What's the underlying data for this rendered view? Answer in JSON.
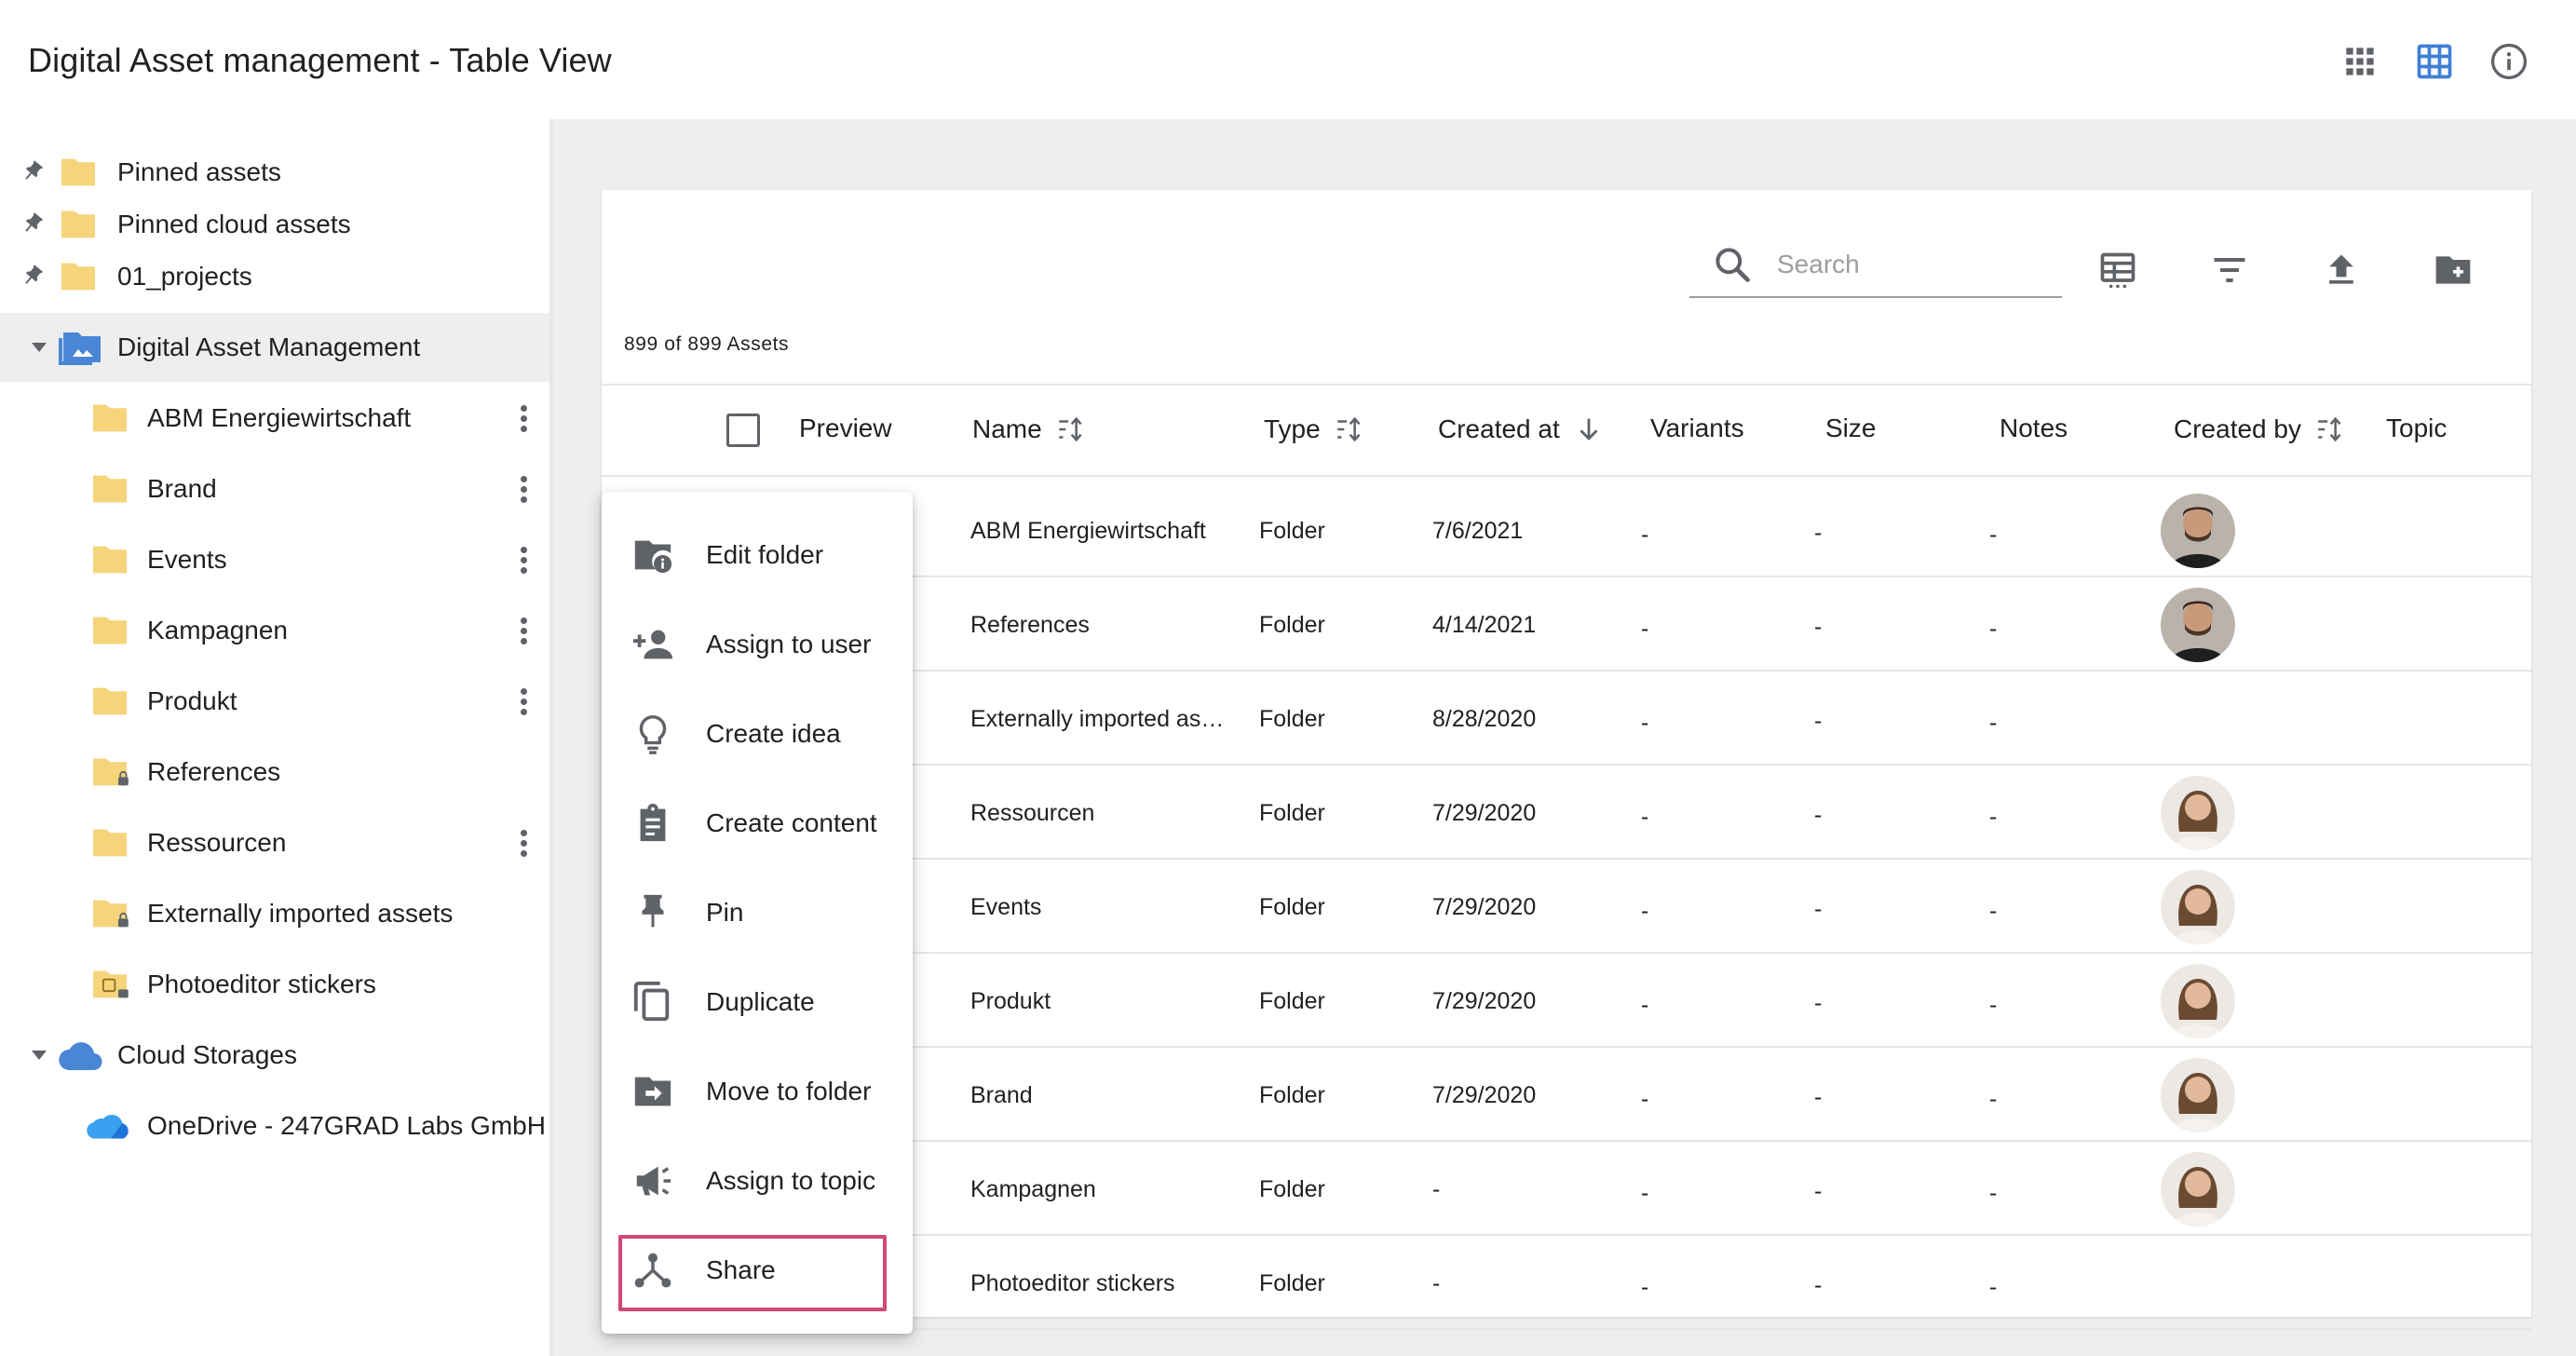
{
  "header": {
    "title": "Digital Asset management - Table View",
    "icons": [
      "grid-view-icon",
      "table-view-icon",
      "info-icon"
    ],
    "active_view_color": "#3f7fd6"
  },
  "sidebar": {
    "pinned": [
      {
        "label": "Pinned assets"
      },
      {
        "label": "Pinned cloud assets"
      },
      {
        "label": "01_projects"
      }
    ],
    "root": {
      "label": "Digital Asset Management"
    },
    "folders": [
      {
        "label": "ABM Energiewirtschaft",
        "menu": true,
        "locked": false
      },
      {
        "label": "Brand",
        "menu": true,
        "locked": false
      },
      {
        "label": "Events",
        "menu": true,
        "locked": false
      },
      {
        "label": "Kampagnen",
        "menu": true,
        "locked": false
      },
      {
        "label": "Produkt",
        "menu": true,
        "locked": false
      },
      {
        "label": "References",
        "menu": false,
        "locked": true
      },
      {
        "label": "Ressourcen",
        "menu": true,
        "locked": false
      },
      {
        "label": "Externally imported assets",
        "menu": false,
        "locked": true
      },
      {
        "label": "Photoeditor stickers",
        "menu": false,
        "locked": true
      }
    ],
    "cloud": {
      "label": "Cloud Storages"
    },
    "cloud_items": [
      {
        "label": "OneDrive - 247GRAD Labs GmbH"
      }
    ],
    "folder_color": "#f5d47a"
  },
  "toolbar": {
    "search_placeholder": "Search",
    "icons": [
      "column-settings-icon",
      "filter-icon",
      "upload-icon",
      "add-folder-icon"
    ]
  },
  "asset_count": "899 of 899 Assets",
  "table": {
    "columns": {
      "preview": "Preview",
      "name": "Name",
      "type": "Type",
      "created_at": "Created at",
      "variants": "Variants",
      "size": "Size",
      "notes": "Notes",
      "created_by": "Created by",
      "topic": "Topic"
    },
    "rows": [
      {
        "name": "ABM Energiewirtschaft",
        "type": "Folder",
        "created": "7/6/2021",
        "variants": "-",
        "size": "-",
        "notes": "-",
        "avatar": "male"
      },
      {
        "name": "References",
        "type": "Folder",
        "created": "4/14/2021",
        "variants": "-",
        "size": "-",
        "notes": "-",
        "avatar": "male"
      },
      {
        "name": "Externally imported ass...",
        "type": "Folder",
        "created": "8/28/2020",
        "variants": "-",
        "size": "-",
        "notes": "-",
        "avatar": "none"
      },
      {
        "name": "Ressourcen",
        "type": "Folder",
        "created": "7/29/2020",
        "variants": "-",
        "size": "-",
        "notes": "-",
        "avatar": "female"
      },
      {
        "name": "Events",
        "type": "Folder",
        "created": "7/29/2020",
        "variants": "-",
        "size": "-",
        "notes": "-",
        "avatar": "female"
      },
      {
        "name": "Produkt",
        "type": "Folder",
        "created": "7/29/2020",
        "variants": "-",
        "size": "-",
        "notes": "-",
        "avatar": "female"
      },
      {
        "name": "Brand",
        "type": "Folder",
        "created": "7/29/2020",
        "variants": "-",
        "size": "-",
        "notes": "-",
        "avatar": "female"
      },
      {
        "name": "Kampagnen",
        "type": "Folder",
        "created": "-",
        "variants": "-",
        "size": "-",
        "notes": "-",
        "avatar": "female"
      },
      {
        "name": "Photoeditor stickers",
        "type": "Folder",
        "created": "-",
        "variants": "-",
        "size": "-",
        "notes": "-",
        "avatar": "none"
      }
    ]
  },
  "context_menu": {
    "items": [
      {
        "label": "Edit folder",
        "icon": "folder-info-icon"
      },
      {
        "label": "Assign to user",
        "icon": "person-add-icon"
      },
      {
        "label": "Create idea",
        "icon": "lightbulb-icon"
      },
      {
        "label": "Create content",
        "icon": "clipboard-icon"
      },
      {
        "label": "Pin",
        "icon": "pin-icon"
      },
      {
        "label": "Duplicate",
        "icon": "copy-icon"
      },
      {
        "label": "Move to folder",
        "icon": "folder-move-icon"
      },
      {
        "label": "Assign to topic",
        "icon": "megaphone-icon"
      },
      {
        "label": "Share",
        "icon": "share-icon"
      }
    ],
    "highlight_color": "#d1477a"
  }
}
